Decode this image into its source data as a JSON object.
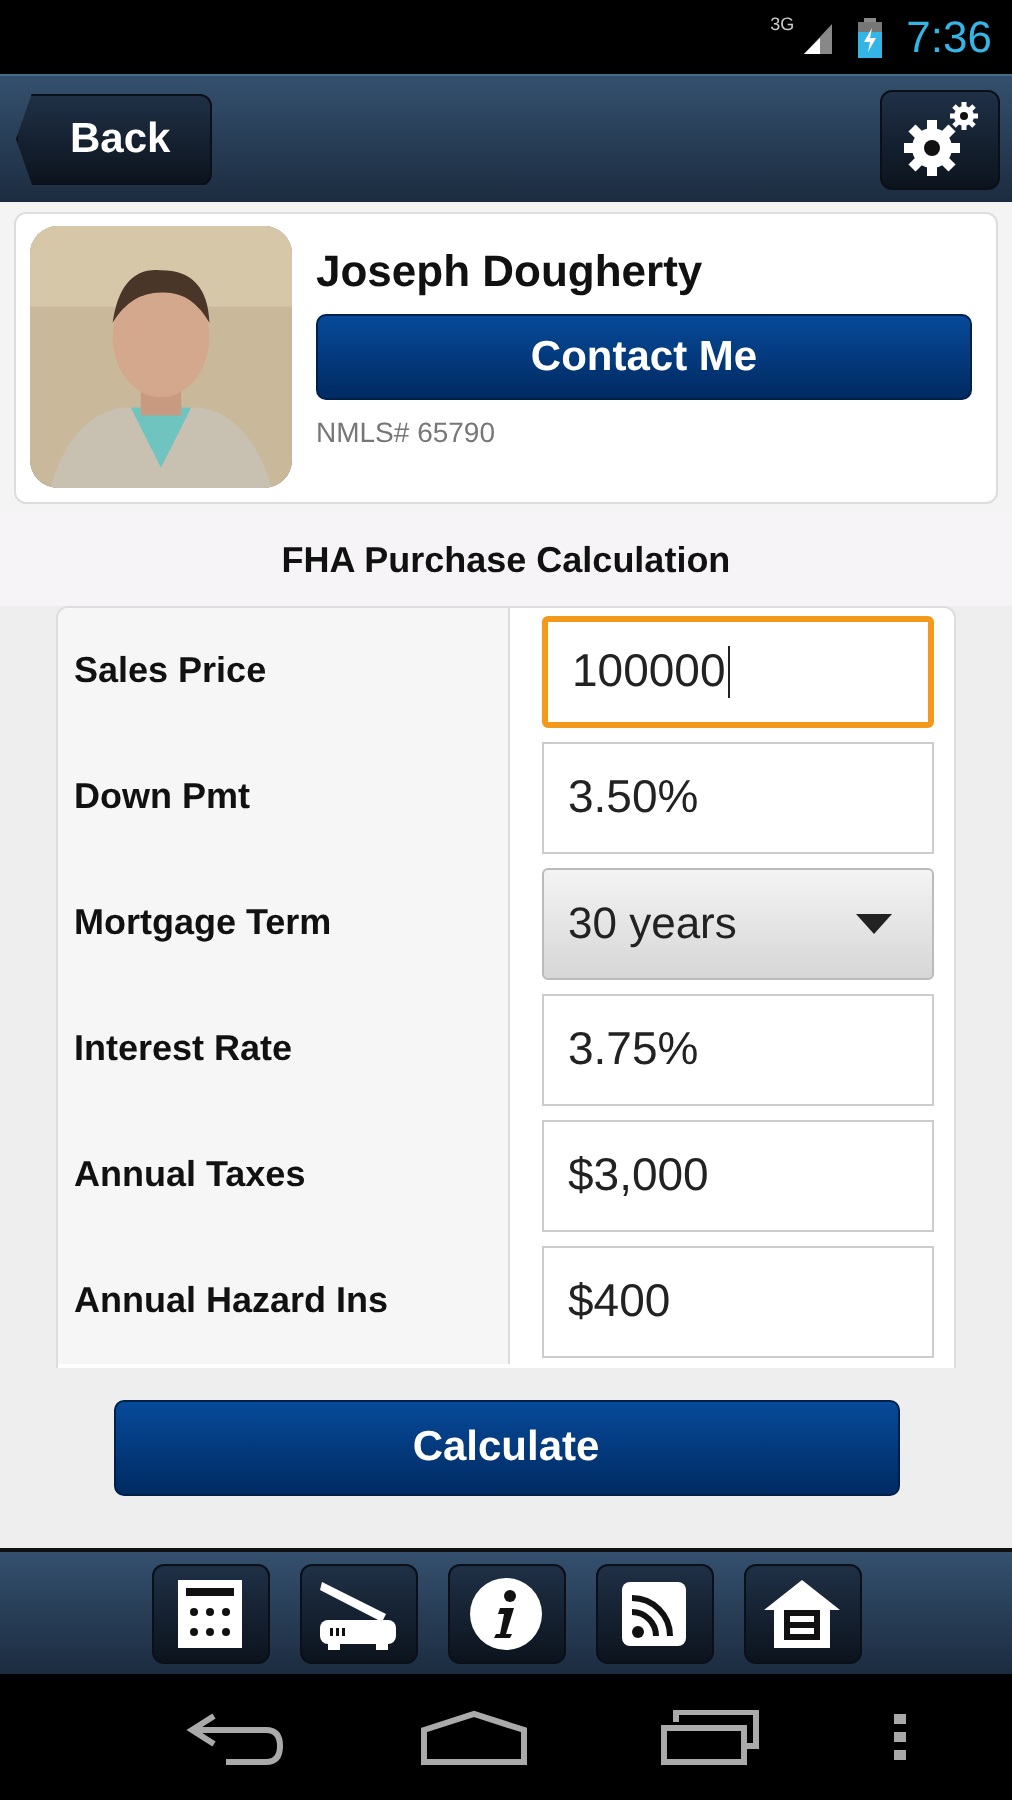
{
  "status_bar": {
    "network": "3G",
    "time": "7:36"
  },
  "header": {
    "back": "Back"
  },
  "profile": {
    "name": "Joseph Dougherty",
    "contact": "Contact Me",
    "nmls": "NMLS# 65790"
  },
  "section_title": "FHA Purchase Calculation",
  "fields": [
    {
      "label": "Sales Price",
      "value": "100000",
      "kind": "text",
      "focused": true
    },
    {
      "label": "Down Pmt",
      "value": "3.50%",
      "kind": "text",
      "focused": false
    },
    {
      "label": "Mortgage Term",
      "value": "30 years",
      "kind": "select",
      "focused": false
    },
    {
      "label": "Interest Rate",
      "value": "3.75%",
      "kind": "text",
      "focused": false
    },
    {
      "label": "Annual Taxes",
      "value": "$3,000",
      "kind": "text",
      "focused": false
    },
    {
      "label": "Annual Hazard Ins",
      "value": "$400",
      "kind": "text",
      "focused": false
    }
  ],
  "calculate": "Calculate",
  "toolbar": [
    {
      "kind": "calculator"
    },
    {
      "kind": "scanner"
    },
    {
      "kind": "info"
    },
    {
      "kind": "rss"
    },
    {
      "kind": "house"
    }
  ]
}
